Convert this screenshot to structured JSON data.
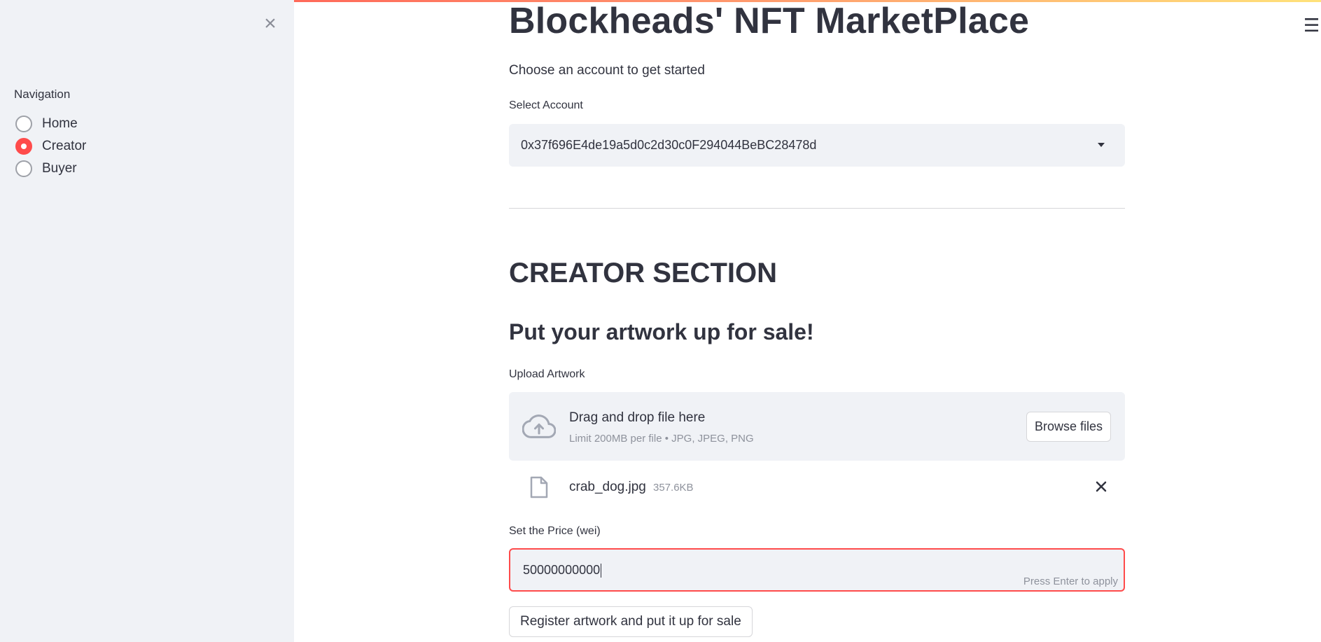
{
  "sidebar": {
    "close_icon": "close-icon",
    "nav_label": "Navigation",
    "items": [
      {
        "label": "Home",
        "selected": false
      },
      {
        "label": "Creator",
        "selected": true
      },
      {
        "label": "Buyer",
        "selected": false
      }
    ]
  },
  "header": {
    "menu_icon": "hamburger-menu-icon",
    "title": "Blockheads' NFT MarketPlace",
    "subtitle": "Choose an account to get started"
  },
  "account": {
    "label": "Select Account",
    "selected": "0x37f696E4de19a5d0c2d30c0F294044BeBC28478d"
  },
  "creator": {
    "section_title": "CREATOR SECTION",
    "subheading": "Put your artwork up for sale!",
    "upload": {
      "label": "Upload Artwork",
      "drop_text": "Drag and drop file here",
      "hint": "Limit 200MB per file • JPG, JPEG, PNG",
      "browse_label": "Browse files",
      "file": {
        "name": "crab_dog.jpg",
        "size": "357.6KB"
      }
    },
    "price": {
      "label": "Set the Price (wei)",
      "value": "50000000000",
      "hint": "Press Enter to apply"
    },
    "submit_label": "Register artwork and put it up for sale"
  },
  "colors": {
    "accent": "#ff4b4b",
    "sidebar_bg": "#f0f2f6",
    "text": "#31333f"
  }
}
